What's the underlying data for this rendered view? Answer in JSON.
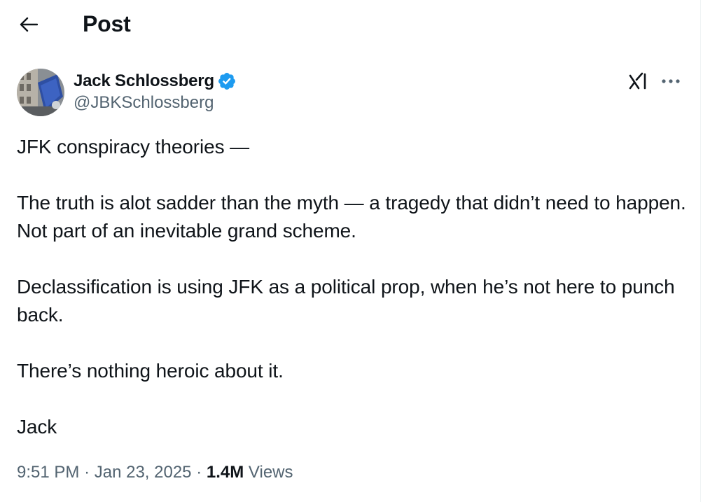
{
  "header": {
    "title": "Post",
    "back_icon": "arrow-left-icon"
  },
  "author": {
    "name": "Jack Schlossberg",
    "handle": "@JBKSchlossberg",
    "verified": true,
    "verified_color": "#1d9bf0"
  },
  "actions": {
    "grok_icon": "grok-icon",
    "more_icon": "more-horizontal-icon"
  },
  "post": {
    "paragraphs": [
      "JFK conspiracy theories —",
      "The truth is alot sadder than the myth — a tragedy that didn’t need to happen. Not part of an inevitable grand scheme.",
      "Declassification is using JFK as a political prop, when he’s not here to punch back.",
      "There’s nothing heroic about it.",
      "Jack"
    ]
  },
  "meta": {
    "time": "9:51 PM",
    "separator": "·",
    "date": "Jan 23, 2025",
    "views_count": "1.4M",
    "views_label": "Views"
  },
  "colors": {
    "text_primary": "#0f1419",
    "text_secondary": "#536471",
    "accent": "#1d9bf0",
    "divider": "#eff3f4"
  }
}
